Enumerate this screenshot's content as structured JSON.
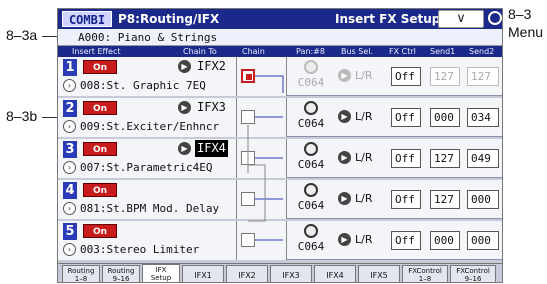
{
  "callouts": {
    "label_a": "8–3a",
    "label_b": "8–3b",
    "label_c": "8–3",
    "label_menu": "Menu"
  },
  "header": {
    "mode": "COMBI",
    "page": "P8:Routing/IFX",
    "subpage": "Insert FX Setup",
    "menu_symbol": "∨"
  },
  "program": {
    "label": "A000: Piano & Strings"
  },
  "columns": {
    "insert_effect": "Insert Effect",
    "chain_to": "Chain To",
    "chain": "Chain",
    "pan": "Pan:#8",
    "bus_sel": "Bus Sel.",
    "fx_ctrl": "FX Ctrl",
    "send1": "Send1",
    "send2": "Send2"
  },
  "rows": [
    {
      "num": "1",
      "on": "On",
      "chain_to": "IFX2",
      "effect": "008:St. Graphic 7EQ",
      "pan": "C064",
      "bus": "L/R",
      "fx_ctrl": "Off",
      "send1": "127",
      "send2": "127"
    },
    {
      "num": "2",
      "on": "On",
      "chain_to": "IFX3",
      "effect": "009:St.Exciter/Enhncr",
      "pan": "C064",
      "bus": "L/R",
      "fx_ctrl": "Off",
      "send1": "000",
      "send2": "034"
    },
    {
      "num": "3",
      "on": "On",
      "chain_to": "IFX4",
      "effect": "007:St.Parametric4EQ",
      "pan": "C064",
      "bus": "L/R",
      "fx_ctrl": "Off",
      "send1": "127",
      "send2": "049"
    },
    {
      "num": "4",
      "on": "On",
      "chain_to": "",
      "effect": "081:St.BPM Mod. Delay",
      "pan": "C064",
      "bus": "L/R",
      "fx_ctrl": "Off",
      "send1": "127",
      "send2": "000"
    },
    {
      "num": "5",
      "on": "On",
      "chain_to": "",
      "effect": "003:Stereo Limiter",
      "pan": "C064",
      "bus": "L/R",
      "fx_ctrl": "Off",
      "send1": "000",
      "send2": "000"
    }
  ],
  "tabs": [
    {
      "l1": "Routing",
      "l2": "1–8"
    },
    {
      "l1": "Routing",
      "l2": "9–16"
    },
    {
      "l1": "IFX",
      "l2": "Setup"
    },
    {
      "l1": "IFX1",
      "l2": ""
    },
    {
      "l1": "IFX2",
      "l2": ""
    },
    {
      "l1": "IFX3",
      "l2": ""
    },
    {
      "l1": "IFX4",
      "l2": ""
    },
    {
      "l1": "IFX5",
      "l2": ""
    },
    {
      "l1": "FXControl",
      "l2": "1–8"
    },
    {
      "l1": "FXControl",
      "l2": "9–16"
    }
  ],
  "glyphs": {
    "arrow": "▶",
    "chevron": "›"
  },
  "colors": {
    "title_bg": "#1b2a8a",
    "on_red": "#c81c1c",
    "slot_blue": "#2a3bb8"
  }
}
